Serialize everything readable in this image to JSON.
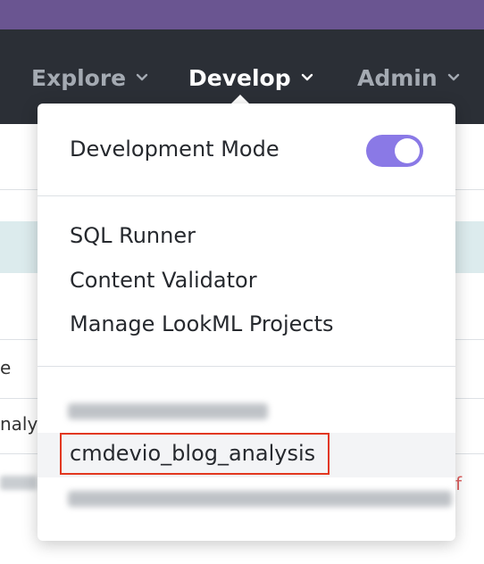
{
  "nav": {
    "items": [
      {
        "label": "Explore",
        "active": false
      },
      {
        "label": "Develop",
        "active": true
      },
      {
        "label": "Admin",
        "active": false
      }
    ]
  },
  "background": {
    "text_e": "e",
    "text_analys": "nalys"
  },
  "menu": {
    "development_mode": {
      "label": "Development Mode",
      "enabled": true
    },
    "tools": [
      {
        "label": "SQL Runner"
      },
      {
        "label": "Content Validator"
      },
      {
        "label": "Manage LookML Projects"
      }
    ],
    "projects": {
      "highlighted": "cmdevio_blog_analysis"
    }
  },
  "colors": {
    "top_strip": "#6a5591",
    "navbar": "#2b2f36",
    "toggle_on": "#8a79e6",
    "highlight_border": "#e2371f"
  }
}
